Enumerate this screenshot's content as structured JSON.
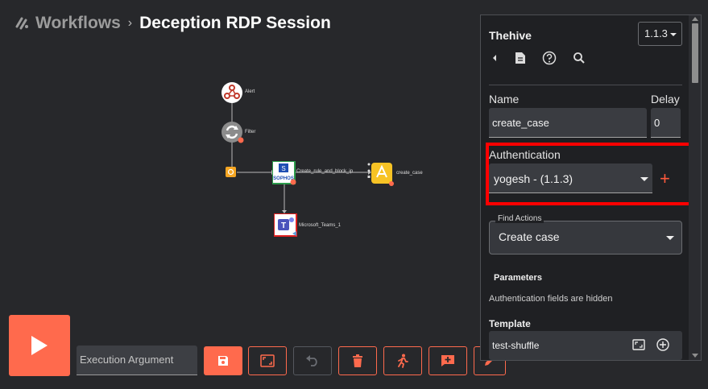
{
  "breadcrumb": {
    "logo_icon": "shuffle-logo-icon",
    "root": "Workflows",
    "separator": "›",
    "current": "Deception RDP Session"
  },
  "graph": {
    "nodes": [
      {
        "label": "Alert",
        "icon": "webhook-icon"
      },
      {
        "label": "Filter",
        "icon": "refresh-icon"
      },
      {
        "label": "",
        "icon": "condition-icon"
      },
      {
        "label": "Create_rule_and_block_ip",
        "icon": "sophos-icon"
      },
      {
        "label": "create_case",
        "icon": "thehive-icon"
      },
      {
        "label": "Microsoft_Teams_1",
        "icon": "microsoft-teams-icon"
      }
    ]
  },
  "toolbar": {
    "run_icon": "play-icon",
    "execution_argument_placeholder": "Execution Argument",
    "buttons": [
      {
        "name": "save",
        "icon": "save-icon"
      },
      {
        "name": "fit-view",
        "icon": "fit-screen-icon"
      },
      {
        "name": "undo",
        "icon": "undo-icon"
      },
      {
        "name": "delete",
        "icon": "trash-icon"
      },
      {
        "name": "run-mode",
        "icon": "running-person-icon"
      },
      {
        "name": "comment",
        "icon": "add-comment-icon"
      },
      {
        "name": "edit",
        "icon": "pencil-icon"
      }
    ]
  },
  "panel": {
    "app_name": "Thehive",
    "version": "1.1.3",
    "icons": [
      "back-arrow-icon",
      "document-icon",
      "help-icon",
      "search-icon"
    ],
    "name_label": "Name",
    "name_value": "create_case",
    "delay_label": "Delay",
    "delay_value": "0",
    "auth_label": "Authentication",
    "auth_value": "yogesh - (1.1.3)",
    "auth_add": "+",
    "find_actions_label": "Find Actions",
    "find_actions_value": "Create case",
    "parameters_label": "Parameters",
    "auth_hidden_note": "Authentication fields are hidden",
    "template_label": "Template",
    "template_value": "test-shuffle"
  },
  "colors": {
    "accent": "#ff6a4d",
    "highlight_box": "#ff0000",
    "background": "#27282b",
    "panel_bg": "#1f2023"
  }
}
